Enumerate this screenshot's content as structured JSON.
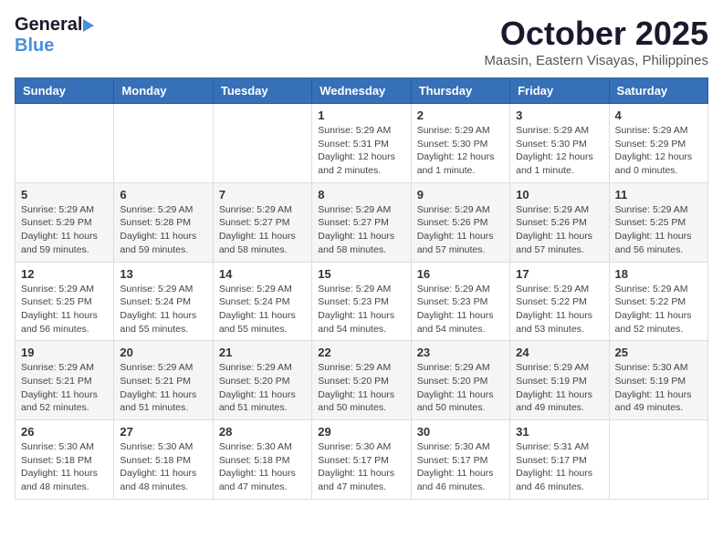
{
  "header": {
    "logo_general": "General",
    "logo_blue": "Blue",
    "month": "October 2025",
    "location": "Maasin, Eastern Visayas, Philippines"
  },
  "weekdays": [
    "Sunday",
    "Monday",
    "Tuesday",
    "Wednesday",
    "Thursday",
    "Friday",
    "Saturday"
  ],
  "weeks": [
    [
      {
        "day": "",
        "info": ""
      },
      {
        "day": "",
        "info": ""
      },
      {
        "day": "",
        "info": ""
      },
      {
        "day": "1",
        "info": "Sunrise: 5:29 AM\nSunset: 5:31 PM\nDaylight: 12 hours\nand 2 minutes."
      },
      {
        "day": "2",
        "info": "Sunrise: 5:29 AM\nSunset: 5:30 PM\nDaylight: 12 hours\nand 1 minute."
      },
      {
        "day": "3",
        "info": "Sunrise: 5:29 AM\nSunset: 5:30 PM\nDaylight: 12 hours\nand 1 minute."
      },
      {
        "day": "4",
        "info": "Sunrise: 5:29 AM\nSunset: 5:29 PM\nDaylight: 12 hours\nand 0 minutes."
      }
    ],
    [
      {
        "day": "5",
        "info": "Sunrise: 5:29 AM\nSunset: 5:29 PM\nDaylight: 11 hours\nand 59 minutes."
      },
      {
        "day": "6",
        "info": "Sunrise: 5:29 AM\nSunset: 5:28 PM\nDaylight: 11 hours\nand 59 minutes."
      },
      {
        "day": "7",
        "info": "Sunrise: 5:29 AM\nSunset: 5:27 PM\nDaylight: 11 hours\nand 58 minutes."
      },
      {
        "day": "8",
        "info": "Sunrise: 5:29 AM\nSunset: 5:27 PM\nDaylight: 11 hours\nand 58 minutes."
      },
      {
        "day": "9",
        "info": "Sunrise: 5:29 AM\nSunset: 5:26 PM\nDaylight: 11 hours\nand 57 minutes."
      },
      {
        "day": "10",
        "info": "Sunrise: 5:29 AM\nSunset: 5:26 PM\nDaylight: 11 hours\nand 57 minutes."
      },
      {
        "day": "11",
        "info": "Sunrise: 5:29 AM\nSunset: 5:25 PM\nDaylight: 11 hours\nand 56 minutes."
      }
    ],
    [
      {
        "day": "12",
        "info": "Sunrise: 5:29 AM\nSunset: 5:25 PM\nDaylight: 11 hours\nand 56 minutes."
      },
      {
        "day": "13",
        "info": "Sunrise: 5:29 AM\nSunset: 5:24 PM\nDaylight: 11 hours\nand 55 minutes."
      },
      {
        "day": "14",
        "info": "Sunrise: 5:29 AM\nSunset: 5:24 PM\nDaylight: 11 hours\nand 55 minutes."
      },
      {
        "day": "15",
        "info": "Sunrise: 5:29 AM\nSunset: 5:23 PM\nDaylight: 11 hours\nand 54 minutes."
      },
      {
        "day": "16",
        "info": "Sunrise: 5:29 AM\nSunset: 5:23 PM\nDaylight: 11 hours\nand 54 minutes."
      },
      {
        "day": "17",
        "info": "Sunrise: 5:29 AM\nSunset: 5:22 PM\nDaylight: 11 hours\nand 53 minutes."
      },
      {
        "day": "18",
        "info": "Sunrise: 5:29 AM\nSunset: 5:22 PM\nDaylight: 11 hours\nand 52 minutes."
      }
    ],
    [
      {
        "day": "19",
        "info": "Sunrise: 5:29 AM\nSunset: 5:21 PM\nDaylight: 11 hours\nand 52 minutes."
      },
      {
        "day": "20",
        "info": "Sunrise: 5:29 AM\nSunset: 5:21 PM\nDaylight: 11 hours\nand 51 minutes."
      },
      {
        "day": "21",
        "info": "Sunrise: 5:29 AM\nSunset: 5:20 PM\nDaylight: 11 hours\nand 51 minutes."
      },
      {
        "day": "22",
        "info": "Sunrise: 5:29 AM\nSunset: 5:20 PM\nDaylight: 11 hours\nand 50 minutes."
      },
      {
        "day": "23",
        "info": "Sunrise: 5:29 AM\nSunset: 5:20 PM\nDaylight: 11 hours\nand 50 minutes."
      },
      {
        "day": "24",
        "info": "Sunrise: 5:29 AM\nSunset: 5:19 PM\nDaylight: 11 hours\nand 49 minutes."
      },
      {
        "day": "25",
        "info": "Sunrise: 5:30 AM\nSunset: 5:19 PM\nDaylight: 11 hours\nand 49 minutes."
      }
    ],
    [
      {
        "day": "26",
        "info": "Sunrise: 5:30 AM\nSunset: 5:18 PM\nDaylight: 11 hours\nand 48 minutes."
      },
      {
        "day": "27",
        "info": "Sunrise: 5:30 AM\nSunset: 5:18 PM\nDaylight: 11 hours\nand 48 minutes."
      },
      {
        "day": "28",
        "info": "Sunrise: 5:30 AM\nSunset: 5:18 PM\nDaylight: 11 hours\nand 47 minutes."
      },
      {
        "day": "29",
        "info": "Sunrise: 5:30 AM\nSunset: 5:17 PM\nDaylight: 11 hours\nand 47 minutes."
      },
      {
        "day": "30",
        "info": "Sunrise: 5:30 AM\nSunset: 5:17 PM\nDaylight: 11 hours\nand 46 minutes."
      },
      {
        "day": "31",
        "info": "Sunrise: 5:31 AM\nSunset: 5:17 PM\nDaylight: 11 hours\nand 46 minutes."
      },
      {
        "day": "",
        "info": ""
      }
    ]
  ]
}
